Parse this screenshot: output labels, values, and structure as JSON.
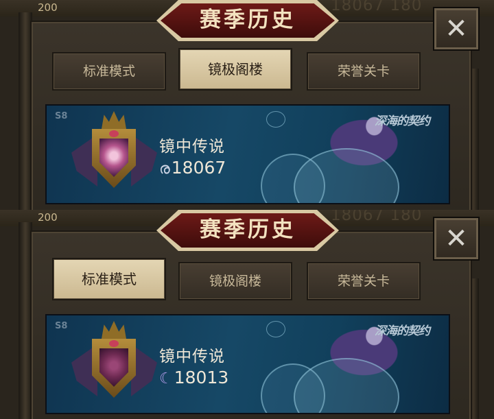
{
  "screens": [
    {
      "id": "top",
      "currency_amount": "200",
      "background_number": "18067 180",
      "title": "赛季历史",
      "close_icon": "close-icon",
      "tabs": [
        {
          "label": "标准模式",
          "active": false
        },
        {
          "label": "镜极阁楼",
          "active": true
        },
        {
          "label": "荣誉关卡",
          "active": false
        }
      ],
      "card": {
        "season": "S8",
        "rank_title": "镜中传说",
        "score_glyph": "ര",
        "score": "18067",
        "banner_logo": "深海的契约"
      }
    },
    {
      "id": "bottom",
      "currency_amount": "200",
      "background_number": "18067 180",
      "title": "赛季历史",
      "close_icon": "close-icon",
      "tabs": [
        {
          "label": "标准模式",
          "active": true
        },
        {
          "label": "镜极阁楼",
          "active": false
        },
        {
          "label": "荣誉关卡",
          "active": false
        }
      ],
      "card": {
        "season": "S8",
        "rank_title": "镜中传说",
        "score_glyph": "☾",
        "score": "18013",
        "banner_logo": "深海的契约"
      }
    }
  ],
  "colors": {
    "title_red": "#6d1a17",
    "title_text": "#f3e2c0",
    "tab_active": "#e4d6b4",
    "tab_inactive": "#483e32",
    "card_blue": "#164866"
  }
}
